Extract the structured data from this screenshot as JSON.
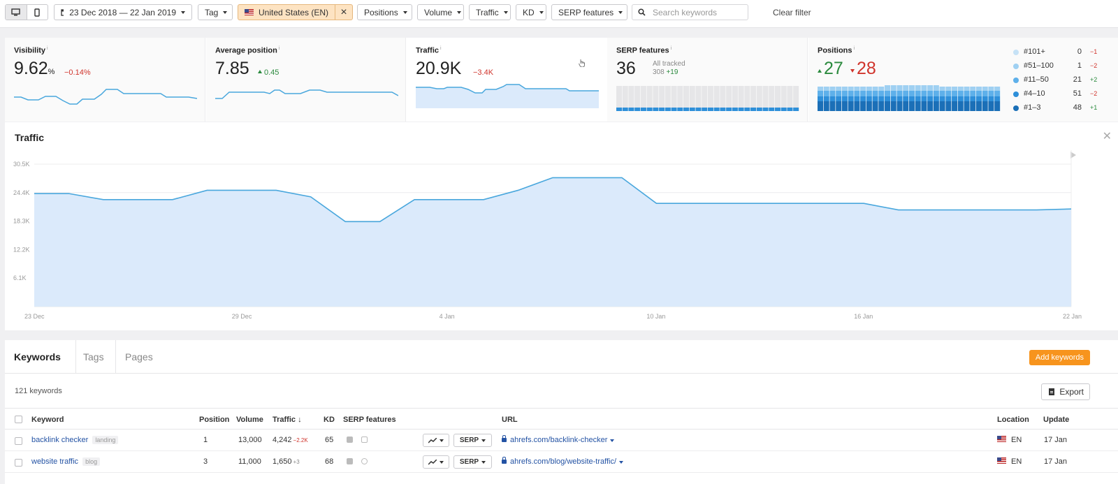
{
  "toolbar": {
    "date_range": "23 Dec 2018 — 22 Jan 2019",
    "tag_label": "Tag",
    "country_label": "United States (EN)",
    "filters": [
      "Positions",
      "Volume",
      "Traffic",
      "KD",
      "SERP features"
    ],
    "search_placeholder": "Search keywords",
    "clear_filter": "Clear filter"
  },
  "metrics": {
    "visibility": {
      "title": "Visibility",
      "value": "9.62",
      "unit": "%",
      "delta": "−0.14%"
    },
    "avg_position": {
      "title": "Average position",
      "value": "7.85",
      "delta": "0.45"
    },
    "traffic": {
      "title": "Traffic",
      "value": "20.9K",
      "delta": "−3.4K"
    },
    "serp": {
      "title": "SERP features",
      "value": "36",
      "tracked_label": "All tracked",
      "tracked_value": "308",
      "tracked_delta": "+19"
    },
    "positions": {
      "title": "Positions",
      "up": "27",
      "down": "28",
      "legend": [
        {
          "name": "#101+",
          "count": "0",
          "change": "−1",
          "color": "#c6e2f6"
        },
        {
          "name": "#51–100",
          "count": "1",
          "change": "−2",
          "color": "#9fd0f2"
        },
        {
          "name": "#11–50",
          "count": "21",
          "change": "+2",
          "color": "#5eb0ea"
        },
        {
          "name": "#4–10",
          "count": "51",
          "change": "−2",
          "color": "#2e8fd9"
        },
        {
          "name": "#1–3",
          "count": "48",
          "change": "+1",
          "color": "#1b6fb7"
        }
      ]
    }
  },
  "traffic_chart": {
    "heading": "Traffic"
  },
  "chart_data": {
    "type": "area",
    "title": "Traffic",
    "xlabel": "",
    "ylabel": "",
    "x_tick_labels": [
      "23 Dec",
      "29 Dec",
      "4 Jan",
      "10 Jan",
      "16 Jan",
      "22 Jan"
    ],
    "y_tick_labels": [
      "6.1K",
      "12.2K",
      "18.3K",
      "24.4K",
      "30.5K"
    ],
    "ylim": [
      0,
      30500
    ],
    "x": [
      "23 Dec",
      "24 Dec",
      "25 Dec",
      "26 Dec",
      "27 Dec",
      "28 Dec",
      "29 Dec",
      "30 Dec",
      "31 Dec",
      "1 Jan",
      "2 Jan",
      "3 Jan",
      "4 Jan",
      "5 Jan",
      "6 Jan",
      "7 Jan",
      "8 Jan",
      "9 Jan",
      "10 Jan",
      "11 Jan",
      "12 Jan",
      "13 Jan",
      "14 Jan",
      "15 Jan",
      "16 Jan",
      "17 Jan",
      "18 Jan",
      "19 Jan",
      "20 Jan",
      "21 Jan",
      "22 Jan"
    ],
    "series": [
      {
        "values": [
          24200,
          24200,
          22900,
          22900,
          22900,
          24900,
          24900,
          24900,
          23500,
          18200,
          18200,
          22900,
          22900,
          22900,
          24900,
          27600,
          27600,
          27600,
          22100,
          22100,
          22100,
          22100,
          22100,
          22100,
          22100,
          20700,
          20700,
          20700,
          20700,
          20700,
          20900
        ]
      }
    ],
    "grid": true,
    "color": "#49a7dd",
    "fill": "#dbeafb"
  },
  "keywords": {
    "tabs": [
      "Keywords",
      "Tags",
      "Pages"
    ],
    "add_button": "Add keywords",
    "count_label": "121 keywords",
    "export_label": "Export",
    "columns": [
      "Keyword",
      "Position",
      "Volume",
      "Traffic ↓",
      "KD",
      "SERP features",
      "URL",
      "Location",
      "Update"
    ],
    "rows": [
      {
        "keyword": "backlink checker",
        "tag": "landing",
        "position": "1",
        "volume": "13,000",
        "traffic": "4,242",
        "traffic_change": "−2.2K",
        "kd": "65",
        "serp_btn": "SERP",
        "url": "ahrefs.com/backlink-checker",
        "location": "EN",
        "update": "17 Jan"
      },
      {
        "keyword": "website traffic",
        "tag": "blog",
        "position": "3",
        "volume": "11,000",
        "traffic": "1,650",
        "traffic_change": "+3",
        "kd": "68",
        "serp_btn": "SERP",
        "url": "ahrefs.com/blog/website-traffic/",
        "location": "EN",
        "update": "17 Jan"
      }
    ]
  }
}
